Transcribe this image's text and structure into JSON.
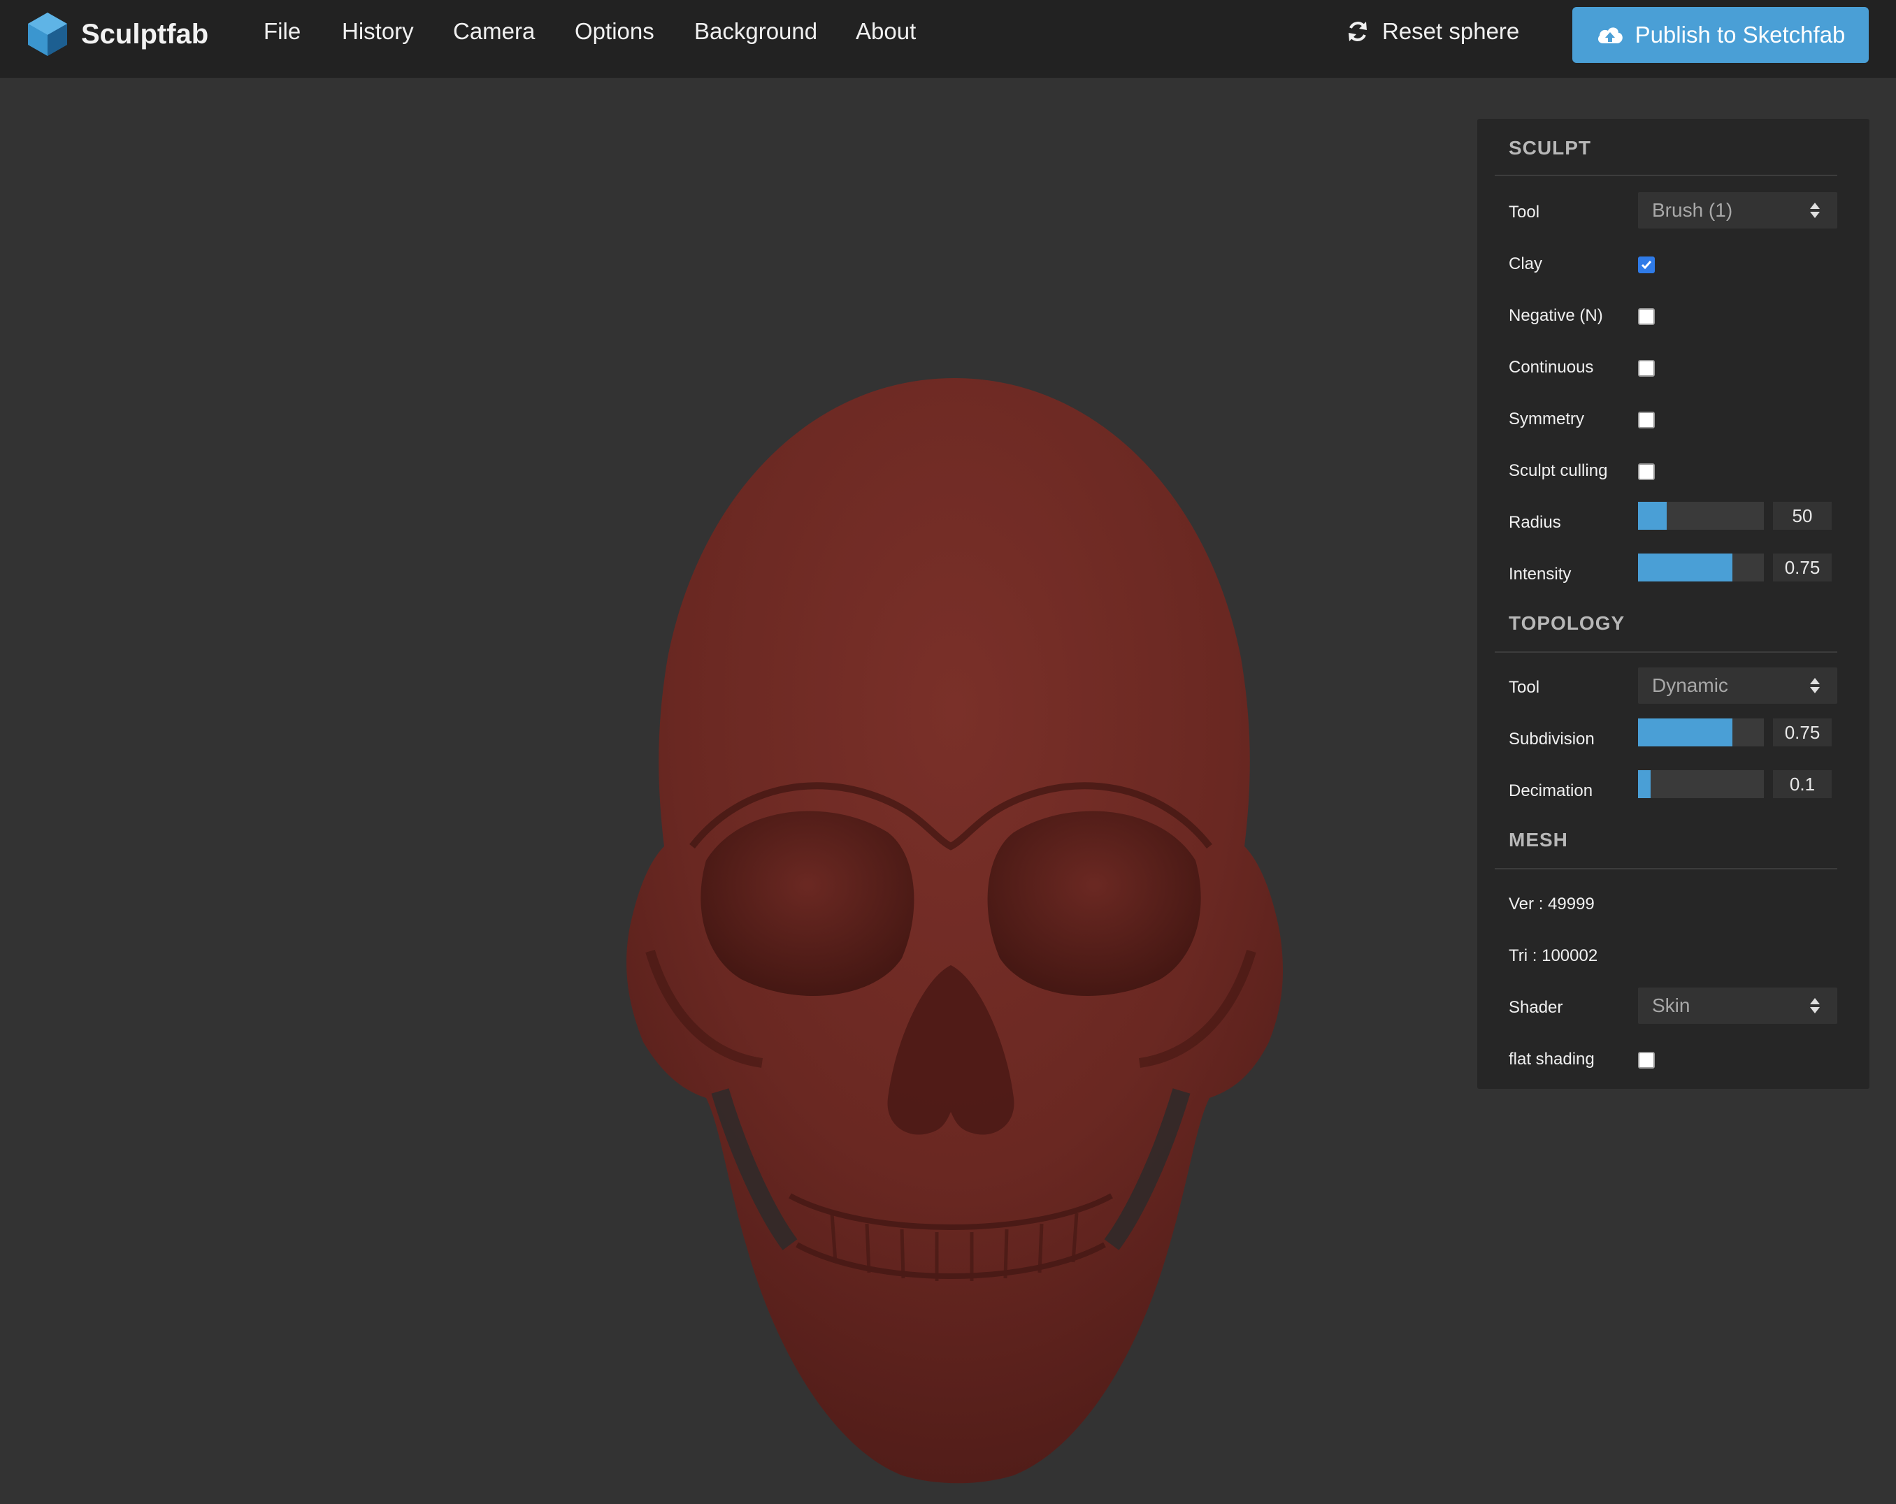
{
  "app": {
    "name": "Sculptfab"
  },
  "menu": [
    "File",
    "History",
    "Camera",
    "Options",
    "Background",
    "About"
  ],
  "toolbar": {
    "reset_label": "Reset sphere",
    "publish_label": "Publish to Sketchfab"
  },
  "colors": {
    "accent": "#4a9fd6",
    "mesh": "#6b2a24",
    "checkbox_checked": "#2f7be8"
  },
  "sculpt": {
    "title": "SCULPT",
    "tool_label": "Tool",
    "tool_value": "Brush (1)",
    "clay_label": "Clay",
    "clay_checked": true,
    "negative_label": "Negative (N)",
    "negative_checked": false,
    "continuous_label": "Continuous",
    "continuous_checked": false,
    "symmetry_label": "Symmetry",
    "symmetry_checked": false,
    "culling_label": "Sculpt culling",
    "culling_checked": false,
    "radius_label": "Radius",
    "radius_value": "50",
    "radius_fraction": 0.23,
    "intensity_label": "Intensity",
    "intensity_value": "0.75",
    "intensity_fraction": 0.75
  },
  "topology": {
    "title": "TOPOLOGY",
    "tool_label": "Tool",
    "tool_value": "Dynamic",
    "subdivision_label": "Subdivision",
    "subdivision_value": "0.75",
    "subdivision_fraction": 0.75,
    "decimation_label": "Decimation",
    "decimation_value": "0.1",
    "decimation_fraction": 0.1
  },
  "mesh": {
    "title": "MESH",
    "vertices": "Ver : 49999",
    "triangles": "Tri : 100002",
    "shader_label": "Shader",
    "shader_value": "Skin",
    "flat_label": "flat shading",
    "flat_checked": false
  }
}
